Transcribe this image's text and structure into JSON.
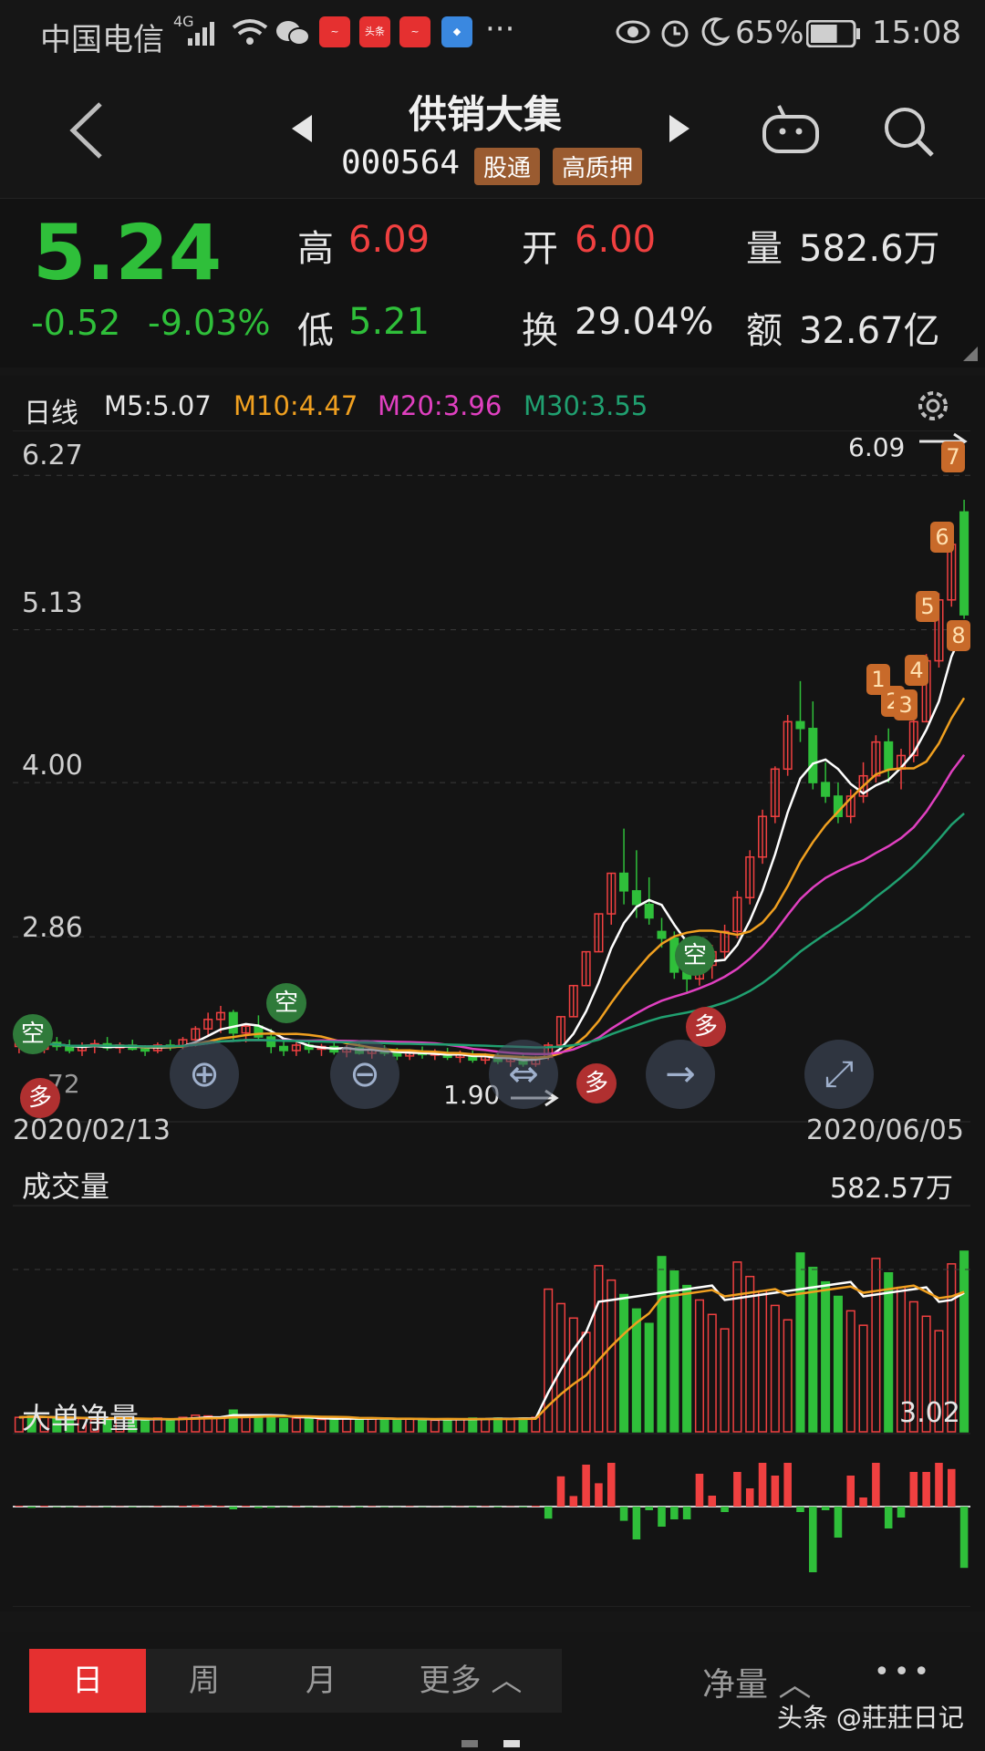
{
  "status_bar": {
    "carrier": "中国电信",
    "network": "4G",
    "app_icons": [
      "toutiao-red-icon",
      "toutiao-icon",
      "toutiao-red-icon",
      "app-blue-icon"
    ],
    "app_icon_labels": [
      "头条"
    ],
    "more": "···",
    "battery": "65%",
    "battery_level": 0.65,
    "time": "15:08"
  },
  "header": {
    "stock_name": "供销大集",
    "stock_code": "000564",
    "tag_connect": "股通",
    "tag_pledge": "高质押"
  },
  "quote": {
    "price": "5.24",
    "change": "-0.52",
    "change_pct": "-9.03%",
    "high_label": "高",
    "high": "6.09",
    "low_label": "低",
    "low": "5.21",
    "open_label": "开",
    "open": "6.00",
    "turnover_label": "换",
    "turnover": "29.04%",
    "volume_label": "量",
    "volume": "582.6万",
    "amount_label": "额",
    "amount": "32.67亿"
  },
  "ma_bar": {
    "period": "日线",
    "ma5": "M5:5.07",
    "ma10": "M10:4.47",
    "ma20": "M20:3.96",
    "ma30": "M30:3.55"
  },
  "price_axis": [
    "6.27",
    "5.13",
    "4.00",
    "2.86"
  ],
  "max_marker": "6.09",
  "min_marker": "1.90",
  "partial_label": "72",
  "signals": {
    "buy": "多",
    "sell": "空"
  },
  "badges": [
    "1",
    "2",
    "3",
    "4",
    "5",
    "6",
    "7",
    "8"
  ],
  "date_start": "2020/02/13",
  "date_end": "2020/06/05",
  "volume_panel": {
    "title": "成交量",
    "value": "582.57万"
  },
  "netflow_panel": {
    "title": "大单净量",
    "value": "3.02"
  },
  "nav_buttons": [
    "zoom-in",
    "zoom-out",
    "pan",
    "next",
    "fullscreen"
  ],
  "bottom_bar": {
    "tabs": [
      "日",
      "周",
      "月",
      "更多"
    ],
    "active": "日",
    "indicator": "净量",
    "more_dots": "•••",
    "watermark": "头条 @莊莊日记"
  },
  "colors": {
    "up": "#f04040",
    "down": "#2fbf3a",
    "ma5": "#ffffff",
    "ma10": "#f0a020",
    "ma20": "#e040c0",
    "ma30": "#20a070",
    "tab_active": "#e53030"
  },
  "chart_data": {
    "type": "candlestick",
    "x_range": [
      "2020/02/13",
      "2020/06/05"
    ],
    "ylim": [
      1.9,
      6.27
    ],
    "y_ticks": [
      6.27,
      5.13,
      4.0,
      2.86
    ],
    "candles": [
      {
        "o": 2.05,
        "h": 2.15,
        "l": 2.0,
        "c": 2.1
      },
      {
        "o": 2.1,
        "h": 2.12,
        "l": 2.0,
        "c": 2.03
      },
      {
        "o": 2.03,
        "h": 2.1,
        "l": 2.0,
        "c": 2.08
      },
      {
        "o": 2.08,
        "h": 2.12,
        "l": 2.02,
        "c": 2.05
      },
      {
        "o": 2.05,
        "h": 2.1,
        "l": 2.0,
        "c": 2.02
      },
      {
        "o": 2.02,
        "h": 2.08,
        "l": 1.98,
        "c": 2.05
      },
      {
        "o": 2.05,
        "h": 2.1,
        "l": 2.0,
        "c": 2.07
      },
      {
        "o": 2.07,
        "h": 2.12,
        "l": 2.02,
        "c": 2.04
      },
      {
        "o": 2.04,
        "h": 2.08,
        "l": 2.0,
        "c": 2.06
      },
      {
        "o": 2.06,
        "h": 2.1,
        "l": 2.02,
        "c": 2.03
      },
      {
        "o": 2.03,
        "h": 2.06,
        "l": 1.98,
        "c": 2.02
      },
      {
        "o": 2.02,
        "h": 2.08,
        "l": 2.0,
        "c": 2.06
      },
      {
        "o": 2.06,
        "h": 2.1,
        "l": 2.02,
        "c": 2.05
      },
      {
        "o": 2.05,
        "h": 2.12,
        "l": 2.03,
        "c": 2.1
      },
      {
        "o": 2.1,
        "h": 2.2,
        "l": 2.05,
        "c": 2.18
      },
      {
        "o": 2.18,
        "h": 2.3,
        "l": 2.12,
        "c": 2.25
      },
      {
        "o": 2.25,
        "h": 2.35,
        "l": 2.15,
        "c": 2.3
      },
      {
        "o": 2.3,
        "h": 2.32,
        "l": 2.1,
        "c": 2.15
      },
      {
        "o": 2.15,
        "h": 2.22,
        "l": 2.08,
        "c": 2.2
      },
      {
        "o": 2.2,
        "h": 2.28,
        "l": 2.1,
        "c": 2.12
      },
      {
        "o": 2.12,
        "h": 2.18,
        "l": 2.0,
        "c": 2.05
      },
      {
        "o": 2.05,
        "h": 2.1,
        "l": 1.98,
        "c": 2.02
      },
      {
        "o": 2.02,
        "h": 2.08,
        "l": 1.98,
        "c": 2.06
      },
      {
        "o": 2.06,
        "h": 2.1,
        "l": 2.0,
        "c": 2.03
      },
      {
        "o": 2.03,
        "h": 2.07,
        "l": 1.98,
        "c": 2.05
      },
      {
        "o": 2.05,
        "h": 2.08,
        "l": 1.99,
        "c": 2.01
      },
      {
        "o": 2.01,
        "h": 2.06,
        "l": 1.97,
        "c": 2.04
      },
      {
        "o": 2.04,
        "h": 2.08,
        "l": 1.99,
        "c": 2.0
      },
      {
        "o": 2.0,
        "h": 2.05,
        "l": 1.96,
        "c": 2.03
      },
      {
        "o": 2.03,
        "h": 2.06,
        "l": 1.98,
        "c": 2.0
      },
      {
        "o": 2.0,
        "h": 2.04,
        "l": 1.95,
        "c": 1.98
      },
      {
        "o": 1.98,
        "h": 2.03,
        "l": 1.95,
        "c": 2.01
      },
      {
        "o": 2.01,
        "h": 2.05,
        "l": 1.96,
        "c": 1.99
      },
      {
        "o": 1.99,
        "h": 2.03,
        "l": 1.95,
        "c": 2.0
      },
      {
        "o": 2.0,
        "h": 2.04,
        "l": 1.95,
        "c": 1.97
      },
      {
        "o": 1.97,
        "h": 2.02,
        "l": 1.93,
        "c": 1.99
      },
      {
        "o": 1.99,
        "h": 2.02,
        "l": 1.93,
        "c": 1.95
      },
      {
        "o": 1.95,
        "h": 2.0,
        "l": 1.92,
        "c": 1.98
      },
      {
        "o": 1.98,
        "h": 2.0,
        "l": 1.92,
        "c": 1.94
      },
      {
        "o": 1.94,
        "h": 1.98,
        "l": 1.9,
        "c": 1.96
      },
      {
        "o": 1.96,
        "h": 2.0,
        "l": 1.9,
        "c": 1.92
      },
      {
        "o": 1.92,
        "h": 1.98,
        "l": 1.9,
        "c": 1.97
      },
      {
        "o": 1.97,
        "h": 2.08,
        "l": 1.95,
        "c": 2.06
      },
      {
        "o": 2.06,
        "h": 2.27,
        "l": 2.06,
        "c": 2.27
      },
      {
        "o": 2.27,
        "h": 2.5,
        "l": 2.27,
        "c": 2.5
      },
      {
        "o": 2.5,
        "h": 2.75,
        "l": 2.5,
        "c": 2.75
      },
      {
        "o": 2.75,
        "h": 3.03,
        "l": 2.75,
        "c": 3.03
      },
      {
        "o": 3.03,
        "h": 3.33,
        "l": 2.95,
        "c": 3.33
      },
      {
        "o": 3.33,
        "h": 3.66,
        "l": 3.1,
        "c": 3.2
      },
      {
        "o": 3.2,
        "h": 3.5,
        "l": 3.0,
        "c": 3.1
      },
      {
        "o": 3.1,
        "h": 3.3,
        "l": 2.95,
        "c": 3.0
      },
      {
        "o": 2.9,
        "h": 3.0,
        "l": 2.78,
        "c": 2.85
      },
      {
        "o": 2.85,
        "h": 2.9,
        "l": 2.55,
        "c": 2.6
      },
      {
        "o": 2.6,
        "h": 2.7,
        "l": 2.45,
        "c": 2.55
      },
      {
        "o": 2.55,
        "h": 2.7,
        "l": 2.5,
        "c": 2.65
      },
      {
        "o": 2.65,
        "h": 2.8,
        "l": 2.55,
        "c": 2.75
      },
      {
        "o": 2.75,
        "h": 2.95,
        "l": 2.7,
        "c": 2.9
      },
      {
        "o": 2.9,
        "h": 3.2,
        "l": 2.85,
        "c": 3.15
      },
      {
        "o": 3.15,
        "h": 3.5,
        "l": 3.1,
        "c": 3.45
      },
      {
        "o": 3.45,
        "h": 3.8,
        "l": 3.4,
        "c": 3.75
      },
      {
        "o": 3.75,
        "h": 4.12,
        "l": 3.7,
        "c": 4.1
      },
      {
        "o": 4.1,
        "h": 4.5,
        "l": 4.05,
        "c": 4.45
      },
      {
        "o": 4.45,
        "h": 4.75,
        "l": 4.3,
        "c": 4.4
      },
      {
        "o": 4.4,
        "h": 4.6,
        "l": 3.95,
        "c": 4.0
      },
      {
        "o": 4.0,
        "h": 4.15,
        "l": 3.85,
        "c": 3.9
      },
      {
        "o": 3.9,
        "h": 4.0,
        "l": 3.7,
        "c": 3.75
      },
      {
        "o": 3.75,
        "h": 3.95,
        "l": 3.7,
        "c": 3.9
      },
      {
        "o": 3.9,
        "h": 4.15,
        "l": 3.85,
        "c": 4.05
      },
      {
        "o": 4.05,
        "h": 4.35,
        "l": 4.0,
        "c": 4.3
      },
      {
        "o": 4.3,
        "h": 4.4,
        "l": 4.0,
        "c": 4.1
      },
      {
        "o": 4.1,
        "h": 4.25,
        "l": 3.95,
        "c": 4.2
      },
      {
        "o": 4.2,
        "h": 4.5,
        "l": 4.15,
        "c": 4.45
      },
      {
        "o": 4.45,
        "h": 4.95,
        "l": 4.45,
        "c": 4.9
      },
      {
        "o": 4.9,
        "h": 5.4,
        "l": 4.85,
        "c": 5.35
      },
      {
        "o": 5.35,
        "h": 5.8,
        "l": 5.3,
        "c": 5.76
      },
      {
        "o": 6.0,
        "h": 6.09,
        "l": 5.21,
        "c": 5.24
      }
    ],
    "ma5_last": 5.07,
    "ma10_last": 4.47,
    "ma20_last": 3.96,
    "ma30_last": 3.55,
    "volume_max": "582.57万",
    "netflow_max": 3.02
  }
}
